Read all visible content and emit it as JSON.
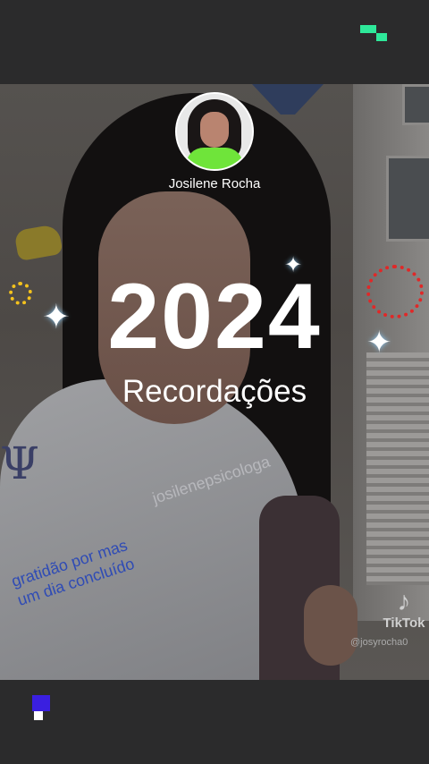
{
  "profile": {
    "name": "Josilene Rocha"
  },
  "card": {
    "year": "2024",
    "subtitle": "Recordações"
  },
  "overlay": {
    "watermark": "josilenepsicologa",
    "caption_line1": "gratidão por mas",
    "caption_line2": "um dia concluído",
    "logo_text": "PSICO"
  },
  "tiktok": {
    "label": "TikTok",
    "handle": "@josyrocha0",
    "icon": "tiktok-note-icon"
  },
  "colors": {
    "accent_green": "#2ee89a",
    "accent_blue": "#3a1fe0",
    "sparkle": "#8fd1ff",
    "flower": "#f4c21d",
    "ring": "#e02828",
    "caption": "#2f4bb5"
  }
}
